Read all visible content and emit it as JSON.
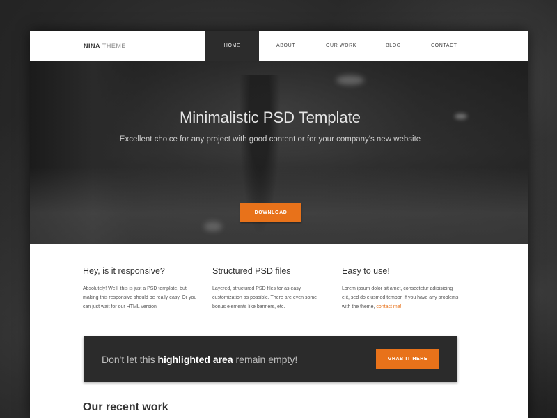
{
  "brand": {
    "bold": "NINA",
    "light": "THEME"
  },
  "nav": {
    "items": [
      "HOME",
      "ABOUT",
      "OUR WORK",
      "BLOG",
      "CONTACT"
    ],
    "active": "HOME"
  },
  "hero": {
    "title": "Minimalistic PSD Template",
    "subtitle": "Excellent choice for any project with good content or for your company's new website",
    "button": "DOWNLOAD",
    "slide_count": 4,
    "active_slide": 1
  },
  "features": [
    {
      "title": "Hey, is it responsive?",
      "text": "Absolutely! Well, this is just a PSD template, but making this responsive should be really easy. Or you can just wait for our HTML version"
    },
    {
      "title": "Structured PSD files",
      "text": "Layered, structured PSD files for as easy customization as possible. There are even some bonus elements like banners, etc."
    },
    {
      "title": "Easy to use!",
      "text": "Lorem ipsum dolor sit amet, consectetur adipisicing elit, sed do eiusmod tempor, if you have any problems with the theme,",
      "link": "contact me!"
    }
  ],
  "highlight": {
    "prefix": "Don't let this ",
    "strong": "highlighted area",
    "suffix": " remain empty!",
    "button": "GRAB IT HERE"
  },
  "recent_work": {
    "title": "Our recent work"
  },
  "colors": {
    "accent": "#e8721a",
    "dark": "#2b2b2b",
    "nav_active": "#2c2c2c"
  }
}
